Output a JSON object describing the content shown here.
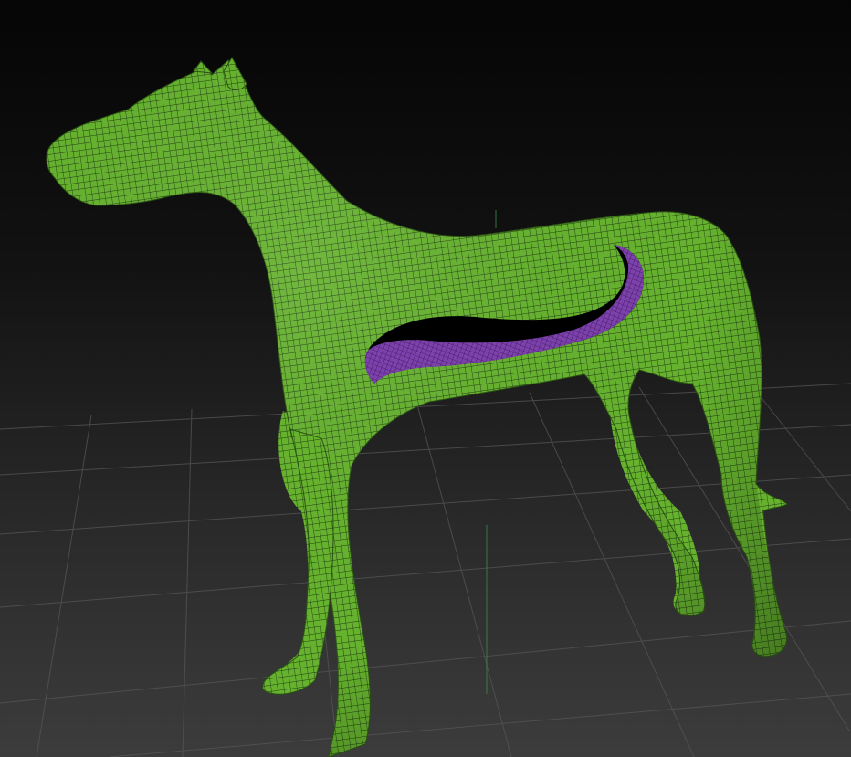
{
  "viewport": {
    "background_top": "#050505",
    "background_bottom": "#3a3a3a",
    "grid_color": "#5a5a5a",
    "axis_color": "#3f8f55"
  },
  "model": {
    "mesh_fill": "#62ad2c",
    "mesh_shadow": "#3e7d1c",
    "wire_color": "#1d3a0c",
    "inner_surface": "#7a3fa8",
    "inner_wire": "#3c1860"
  }
}
